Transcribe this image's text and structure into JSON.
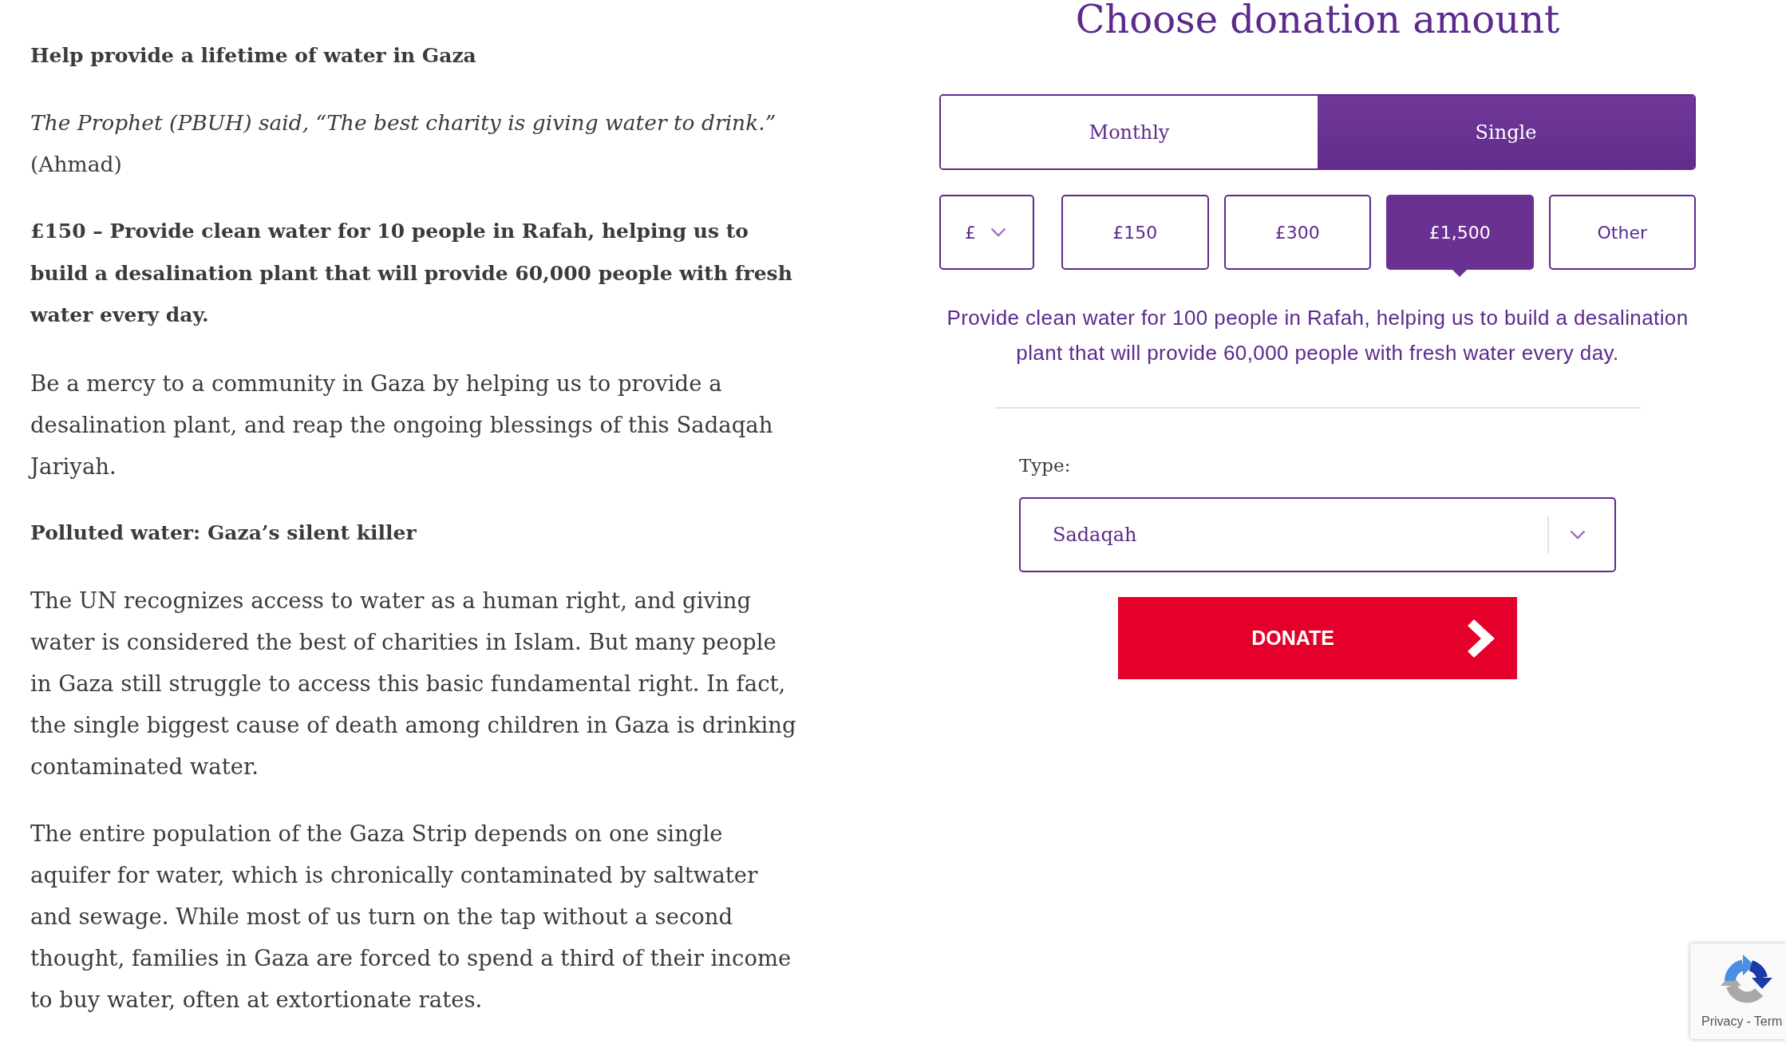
{
  "article": {
    "blocks": [
      {
        "kind": "heading",
        "text": "Help provide a lifetime of water in Gaza"
      },
      {
        "kind": "quote",
        "text": "*The Prophet (PBUH) said, “The best charity is giving water to drink.”* (Ahmad)"
      },
      {
        "kind": "lead",
        "text": "£150 – Provide clean water for 10 people in Rafah, helping us to build a desalination plant that will provide 60,000 people with fresh water every day."
      },
      {
        "kind": "paragraph",
        "text": "Be a mercy to a community in Gaza by helping us to provide a desalination plant, and reap the ongoing blessings of this Sadaqah Jariyah."
      },
      {
        "kind": "heading",
        "text": "Polluted water: Gaza’s silent killer"
      },
      {
        "kind": "paragraph",
        "text": "The UN recognizes access to water as a human right, and giving water is considered the best of charities in Islam. But many people in Gaza still struggle to access this basic fundamental right. In fact, the single biggest cause of death among children in Gaza is drinking contaminated water."
      },
      {
        "kind": "paragraph",
        "text": "The entire population of the Gaza Strip depends on one single aquifer for water, which is chronically contaminated by saltwater and sewage. While most of us turn on the tap without a second thought, families in Gaza are forced to spend a third of their income to buy water, often at extortionate rates."
      }
    ]
  },
  "donation": {
    "title": "Choose donation amount",
    "frequency_tabs": [
      {
        "label": "Monthly",
        "selected": false
      },
      {
        "label": "Single",
        "selected": true
      }
    ],
    "currency": {
      "value": "£"
    },
    "amounts": [
      {
        "label": "£150",
        "selected": false
      },
      {
        "label": "£300",
        "selected": false
      },
      {
        "label": "£1,500",
        "selected": true
      },
      {
        "label": "Other",
        "selected": false
      }
    ],
    "description": "Provide clean water for 100 people in Rafah, helping us to build a desalination plant that will provide 60,000 people with fresh water every day.",
    "type_field": {
      "label": "Type:",
      "value": "Sadaqah"
    },
    "donate_button": {
      "label": "DONATE"
    }
  },
  "recaptcha_badge": {
    "privacy_link": "Privacy",
    "separator": "-",
    "terms_link": "Term"
  }
}
